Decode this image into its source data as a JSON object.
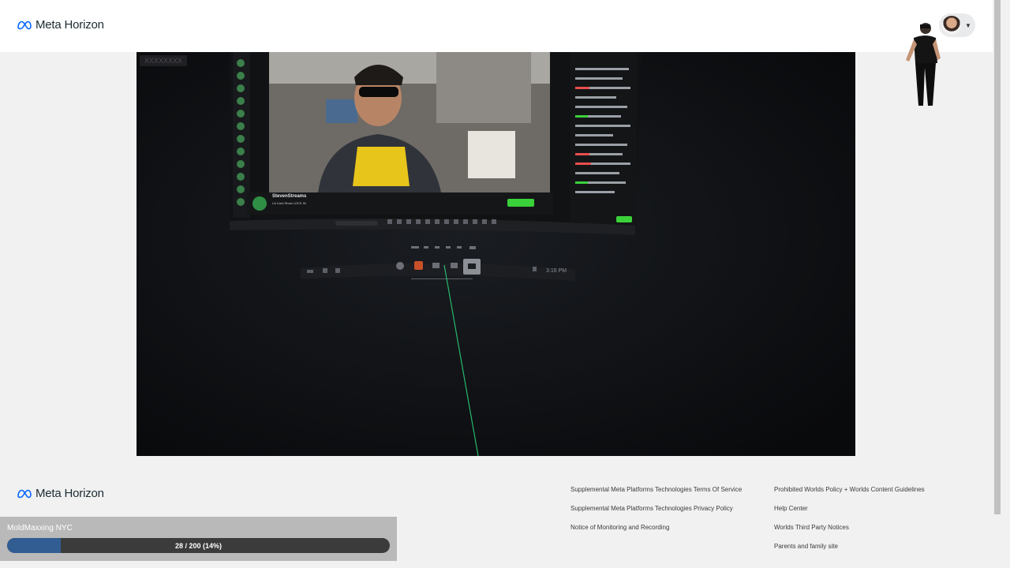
{
  "header": {
    "brand": "Meta Horizon",
    "profile_menu_icon": "chevron-down-icon"
  },
  "video": {
    "tag": "XXXXXXXX",
    "stream": {
      "name": "StevenStreams",
      "subtitle": "LA Card Show LOCK IN"
    },
    "clock": "3:16 PM",
    "accent_colors": {
      "chat_green": "#3ad13a",
      "laser": "#2bd67b"
    }
  },
  "footer": {
    "brand": "Meta Horizon",
    "links_col1": [
      "Supplemental Meta Platforms Technologies Terms Of Service",
      "Supplemental Meta Platforms Technologies Privacy Policy",
      "Notice of Monitoring and Recording"
    ],
    "links_col2": [
      "Prohibited Worlds Policy + Worlds Content Guidelines",
      "Help Center",
      "Worlds Third Party Notices",
      "Parents and family site"
    ]
  },
  "progress": {
    "title": "MoldMaxxing NYC",
    "current": 28,
    "total": 200,
    "fraction": 0.14,
    "label": "28 / 200 (14%)",
    "fill_color": "#315d93"
  }
}
